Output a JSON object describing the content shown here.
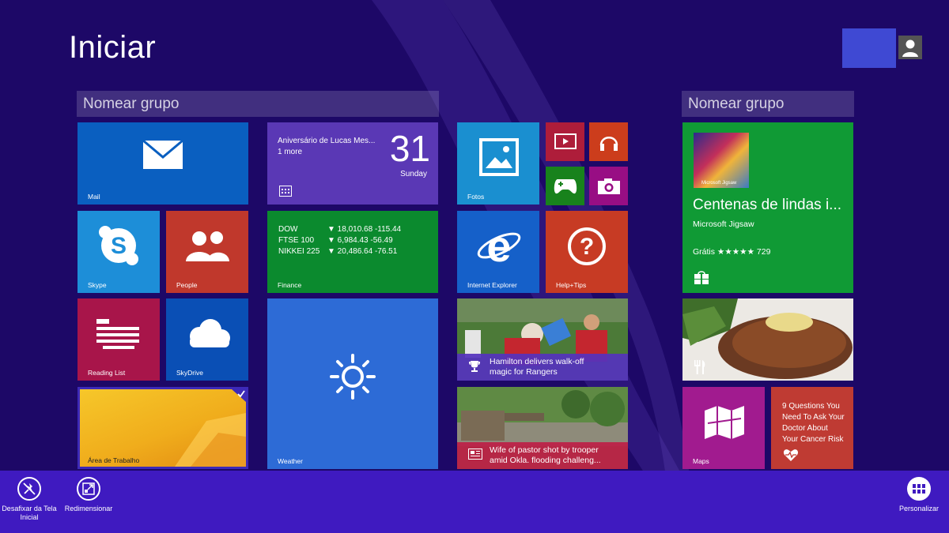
{
  "start": {
    "title": "Iniciar"
  },
  "groups": [
    {
      "name": "Nomear grupo"
    },
    {
      "name": "Nomear grupo"
    }
  ],
  "tiles": {
    "mail": {
      "label": "Mail",
      "color": "#0a5fc0"
    },
    "calendar": {
      "event": "Aniversário de Lucas Mes...",
      "more": "1 more",
      "day": "31",
      "weekday": "Sunday",
      "color": "#5a38b5"
    },
    "photos": {
      "label": "Fotos",
      "color": "#1a8fd0"
    },
    "video": {
      "color": "#ae1d3a"
    },
    "music": {
      "color": "#cc3d1c"
    },
    "games": {
      "color": "#18821c"
    },
    "camera": {
      "color": "#980e84"
    },
    "skype": {
      "label": "Skype",
      "color": "#1d8ed8"
    },
    "people": {
      "label": "People",
      "color": "#c0382c"
    },
    "finance": {
      "label": "Finance",
      "color": "#0b8a2e",
      "rows": [
        {
          "name": "DOW",
          "value": "▼ 18,010.68 -115.44"
        },
        {
          "name": "FTSE 100",
          "value": "▼ 6,984.43 -56.49"
        },
        {
          "name": "NIKKEI 225",
          "value": "▼ 20,486.64 -76.51"
        }
      ]
    },
    "ie": {
      "label": "Internet Explorer",
      "color": "#1560c9"
    },
    "help": {
      "label": "Help+Tips",
      "color": "#c73b24"
    },
    "reading": {
      "label": "Reading List",
      "color": "#a8154a"
    },
    "skydrive": {
      "label": "SkyDrive",
      "color": "#0a4fb5"
    },
    "weather": {
      "label": "Weather",
      "color": "#2d6bd6"
    },
    "sports": {
      "caption_line1": "Hamilton delivers walk-off",
      "caption_line2": "magic for Rangers"
    },
    "news": {
      "caption_line1": "Wife of pastor shot by trooper",
      "caption_line2": "amid Okla. flooding challeng..."
    },
    "desktop": {
      "label": "Área de Trabalho"
    },
    "store": {
      "badge": "Microsoft Jigsaw",
      "title": "Centenas de lindas i...",
      "app": "Microsoft Jigsaw",
      "rating": "Grátis ★★★★★ 729",
      "color": "#109a35"
    },
    "maps": {
      "label": "Maps",
      "color": "#a11b8f"
    },
    "health": {
      "text_line1": "9 Questions You",
      "text_line2": "Need To Ask Your",
      "text_line3": "Doctor About",
      "text_line4": "Your Cancer Risk",
      "color": "#bf3b33"
    }
  },
  "appbar": {
    "unpin_line1": "Desafixar da Tela",
    "unpin_line2": "Inicial",
    "resize": "Redimensionar",
    "customize": "Personalizar"
  }
}
